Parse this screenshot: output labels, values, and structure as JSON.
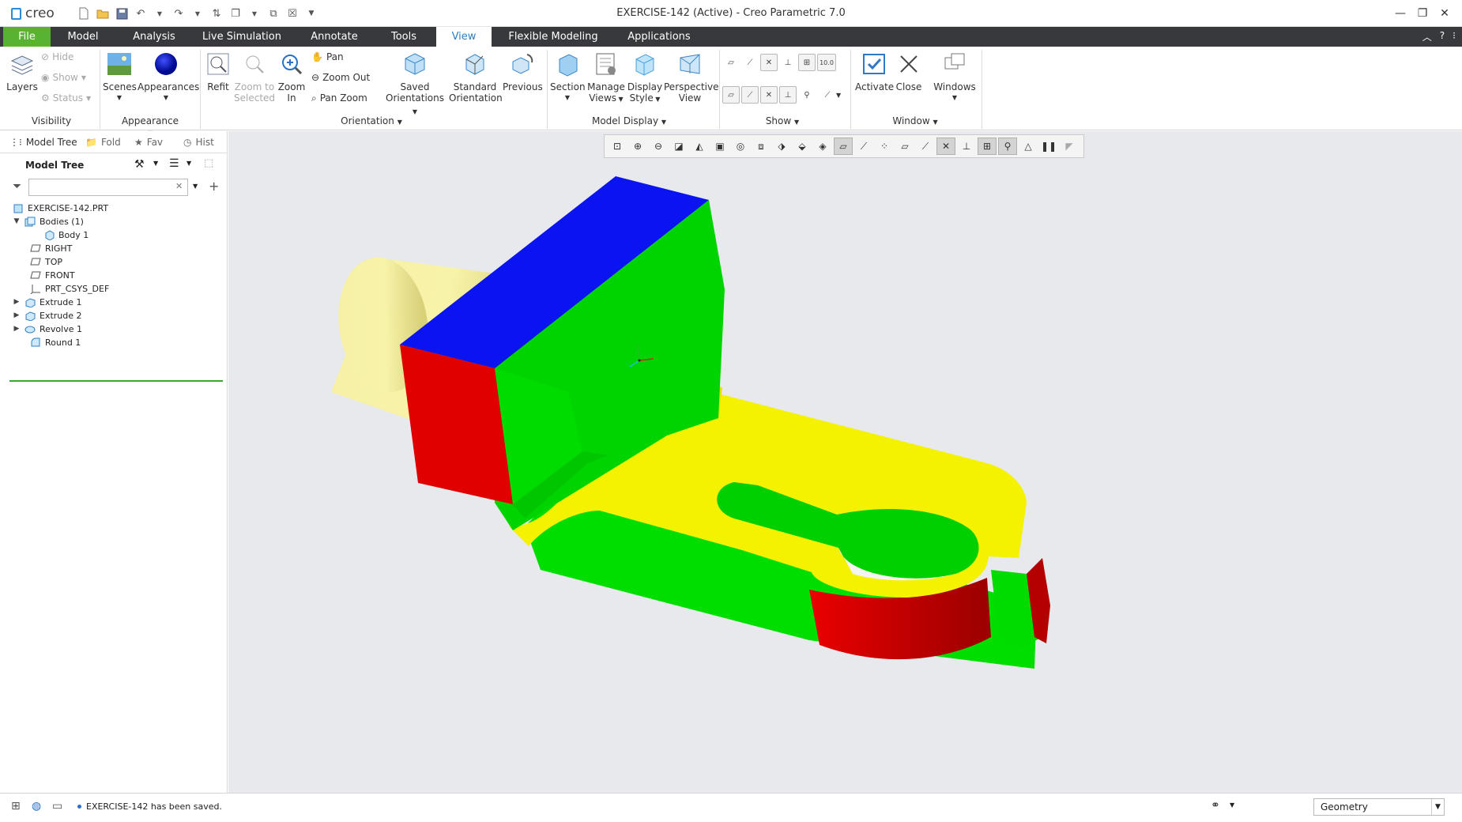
{
  "app": {
    "logo_text": "creo",
    "window_title": "EXERCISE-142 (Active) - Creo Parametric 7.0"
  },
  "tabs": [
    "File",
    "Model",
    "Analysis",
    "Live Simulation",
    "Annotate",
    "Tools",
    "View",
    "Flexible Modeling",
    "Applications"
  ],
  "active_tab": "View",
  "ribbon": {
    "visibility": {
      "layers": "Layers",
      "hide": "Hide",
      "show": "Show",
      "status": "Status",
      "group": "Visibility"
    },
    "appearance": {
      "scenes": "Scenes",
      "appearances": "Appearances",
      "group": "Appearance"
    },
    "orientation": {
      "refit": "Refit",
      "zoom_selected_1": "Zoom to",
      "zoom_selected_2": "Selected",
      "zoom_in_1": "Zoom",
      "zoom_in_2": "In",
      "pan": "Pan",
      "zoom_out": "Zoom Out",
      "pan_zoom": "Pan Zoom",
      "saved_1": "Saved",
      "saved_2": "Orientations",
      "standard_1": "Standard",
      "standard_2": "Orientation",
      "previous": "Previous",
      "group": "Orientation"
    },
    "model_display": {
      "section": "Section",
      "manage_1": "Manage",
      "manage_2": "Views",
      "display_1": "Display",
      "display_2": "Style",
      "perspective_1": "Perspective",
      "perspective_2": "View",
      "group": "Model Display"
    },
    "show": {
      "group": "Show",
      "label_10": "10.0"
    },
    "window": {
      "activate": "Activate",
      "close": "Close",
      "windows": "Windows",
      "group": "Window"
    }
  },
  "left_panel": {
    "nav_tabs": [
      "Model Tree",
      "Fold",
      "Fav",
      "Hist"
    ],
    "title": "Model Tree",
    "filter_placeholder": "",
    "tree": [
      {
        "label": "EXERCISE-142.PRT",
        "level": 0,
        "expander": "",
        "icon": "part-icon"
      },
      {
        "label": "Bodies (1)",
        "level": 0,
        "expander": "open",
        "icon": "bodies-icon"
      },
      {
        "label": "Body 1",
        "level": 2,
        "expander": "",
        "icon": "body-icon"
      },
      {
        "label": "RIGHT",
        "level": 1,
        "expander": "",
        "icon": "datum-plane-icon"
      },
      {
        "label": "TOP",
        "level": 1,
        "expander": "",
        "icon": "datum-plane-icon"
      },
      {
        "label": "FRONT",
        "level": 1,
        "expander": "",
        "icon": "datum-plane-icon"
      },
      {
        "label": "PRT_CSYS_DEF",
        "level": 1,
        "expander": "",
        "icon": "csys-icon"
      },
      {
        "label": "Extrude 1",
        "level": 0,
        "expander": "closed",
        "icon": "extrude-icon"
      },
      {
        "label": "Extrude 2",
        "level": 0,
        "expander": "closed",
        "icon": "extrude-icon"
      },
      {
        "label": "Revolve 1",
        "level": 0,
        "expander": "closed",
        "icon": "revolve-icon"
      },
      {
        "label": "Round 1",
        "level": 1,
        "expander": "",
        "icon": "round-icon"
      }
    ]
  },
  "status": {
    "message": "EXERCISE-142 has been saved.",
    "filter_value": "Geometry"
  },
  "colors": {
    "file_tab": "#58b430",
    "tab_bar": "#37393c",
    "active_tab_text": "#2e7dc1",
    "viewport_bg": "#e7e9ed",
    "model_blue": "#0a14f0",
    "model_green": "#00e000",
    "model_yellow": "#f2f000",
    "model_red": "#e00000",
    "model_pale_yellow": "#f7f3a0"
  }
}
